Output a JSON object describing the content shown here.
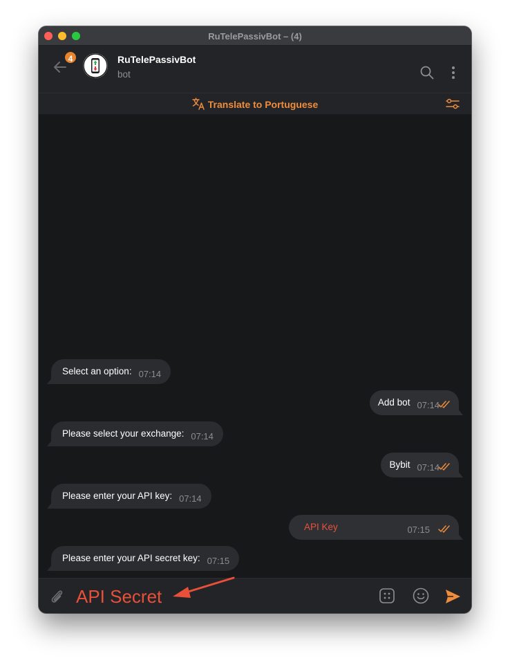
{
  "window": {
    "title": "RuTelePassivBot – (4)"
  },
  "header": {
    "unread_badge": "4",
    "chat_name": "RuTelePassivBot",
    "chat_subtitle": "bot",
    "icons": [
      "back-arrow-icon",
      "bot-avatar",
      "search-icon",
      "more-vertical-icon"
    ]
  },
  "translate_bar": {
    "label": "Translate to Portuguese",
    "icons": [
      "translate-icon",
      "settings-sliders-icon"
    ]
  },
  "messages": [
    {
      "direction": "in",
      "text": "Select an option:",
      "time": "07:14"
    },
    {
      "direction": "out",
      "text": "Add bot",
      "time": "07:14",
      "status": "read"
    },
    {
      "direction": "in",
      "text": "Please select your exchange:",
      "time": "07:14"
    },
    {
      "direction": "out",
      "text": "Bybit",
      "time": "07:14",
      "status": "read"
    },
    {
      "direction": "in",
      "text": "Please enter your API key:",
      "time": "07:14"
    },
    {
      "direction": "out",
      "text": "API Key",
      "time": "07:15",
      "status": "read"
    },
    {
      "direction": "in",
      "text": "Please enter your API secret key:",
      "time": "07:15"
    }
  ],
  "composer": {
    "value": "API Secret",
    "icons": [
      "paperclip-icon",
      "stickers-icon",
      "emoji-icon",
      "send-icon"
    ]
  },
  "colors": {
    "accent": "#f08d3c",
    "annotation_red": "#e8503a",
    "background": "#17181a",
    "bubble": "#2b2c30"
  }
}
